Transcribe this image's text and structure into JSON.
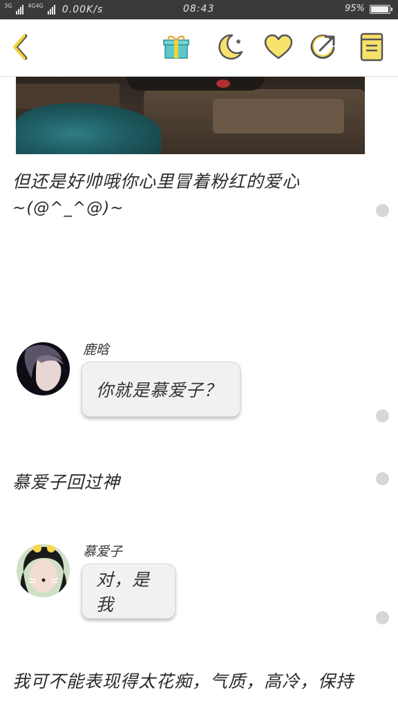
{
  "status_bar": {
    "network_small": "3G",
    "network_dual": "4G4G",
    "speed": "0.00K/s",
    "time": "08:43",
    "battery": "95%",
    "battery_level": 0.95
  },
  "toolbar": {
    "icons": [
      "back-chevron-icon",
      "gift-icon",
      "moon-icon",
      "heart-icon",
      "share-icon",
      "book-icon"
    ],
    "accent": "#f2d23a"
  },
  "story": {
    "narration_1": "但还是好帅哦你心里冒着粉红的爱心",
    "narration_1_emoticon": "~(@^_^@)~",
    "narration_2": "慕爱子回过神",
    "narration_3": "我可不能表现得太花痴，气质，高冷，保持",
    "messages": [
      {
        "speaker": "鹿晗",
        "text": "你就是慕爱子？"
      },
      {
        "speaker": "慕爱子",
        "text": "对，是我"
      }
    ]
  }
}
